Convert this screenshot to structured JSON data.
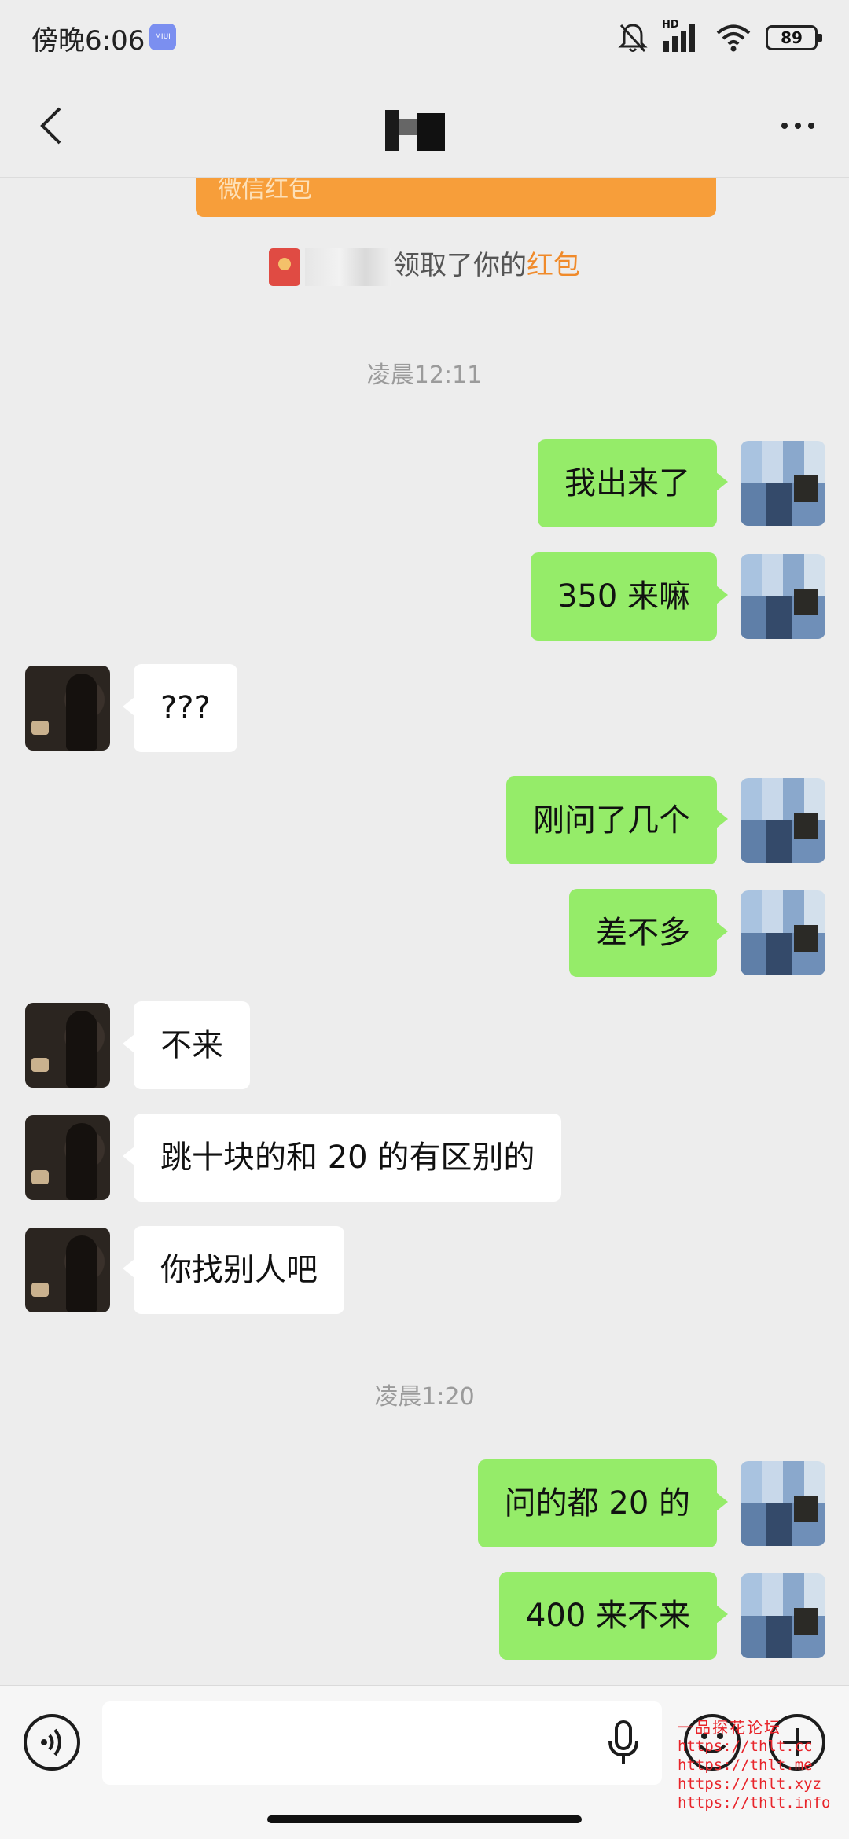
{
  "status_bar": {
    "time": "傍晚6:06",
    "miui_badge": "MIUI",
    "network": "HD",
    "battery": "89",
    "icons": [
      "mute-bell-icon",
      "signal-icon",
      "wifi-icon",
      "battery-icon"
    ]
  },
  "nav": {
    "back_icon": "chevron-left-icon",
    "title": "",
    "more_icon": "more-dots-icon"
  },
  "red_packet": {
    "label": "微信红包",
    "notice_prefix": "领取了你的",
    "notice_highlight": "红包"
  },
  "conversation": {
    "timestamp_1": "凌晨12:11",
    "timestamp_2": "凌晨1:20",
    "messages": [
      {
        "side": "out",
        "text": "我出来了"
      },
      {
        "side": "out",
        "text": "350 来嘛"
      },
      {
        "side": "in",
        "text": "???"
      },
      {
        "side": "out",
        "text": "刚问了几个"
      },
      {
        "side": "out",
        "text": "差不多"
      },
      {
        "side": "in",
        "text": "不来"
      },
      {
        "side": "in",
        "text": "跳十块的和 20 的有区别的"
      },
      {
        "side": "in",
        "text": "你找别人吧"
      },
      {
        "side": "out",
        "text": "问的都 20 的"
      },
      {
        "side": "out",
        "text": "400 来不来"
      }
    ]
  },
  "input_bar": {
    "value": "",
    "icons": [
      "voice-icon",
      "mic-icon",
      "emoji-icon",
      "plus-icon"
    ]
  },
  "watermark": {
    "title": "一品探花论坛",
    "lines": [
      "https://thlt.cc",
      "https://thlt.me",
      "https://thlt.xyz",
      "https://thlt.info"
    ]
  },
  "colors": {
    "background": "#ededed",
    "outgoing_bubble": "#95ec69",
    "incoming_bubble": "#ffffff",
    "red_packet": "#f79e3a",
    "highlight": "#f08a2a",
    "watermark": "#e8242a"
  }
}
